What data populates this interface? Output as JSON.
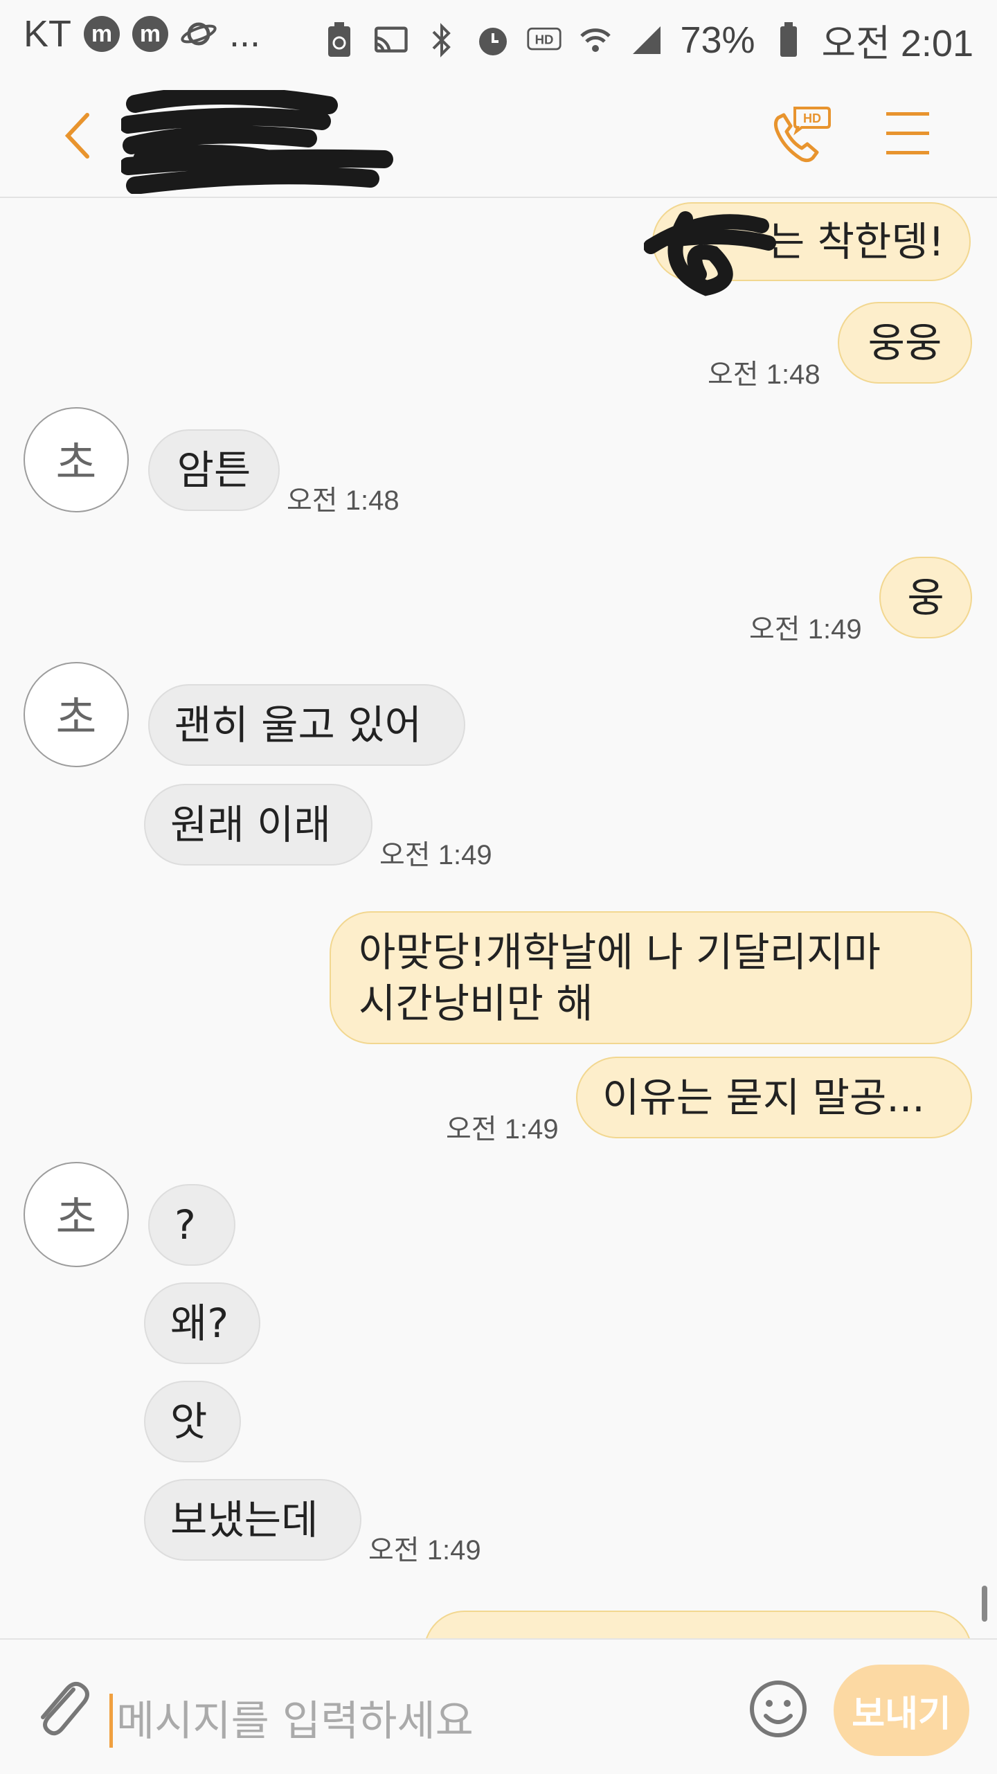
{
  "status_bar": {
    "carrier": "KT",
    "dots": "...",
    "battery_percent": "73%",
    "time": "오전 2:01",
    "icons": [
      "m-app-icon",
      "m-app-icon",
      "planet-icon",
      "battery-saver-icon",
      "cast-icon",
      "bluetooth-icon",
      "alarm-icon",
      "hd-icon",
      "wifi-icon",
      "signal-icon",
      "battery-icon"
    ]
  },
  "header": {
    "contact_name": "",
    "contact_number": "",
    "call_badge": "HD",
    "accent": "#e8942e"
  },
  "messages": {
    "m1": {
      "text": "는 착한뎅!",
      "direction": "out"
    },
    "m2": {
      "text": "웅웅",
      "direction": "out",
      "time": "오전 1:48"
    },
    "m3": {
      "text": "암튼",
      "direction": "in",
      "time": "오전 1:48"
    },
    "m4": {
      "text": "웅",
      "direction": "out",
      "time": "오전 1:49"
    },
    "m5": {
      "text": "괜히 울고 있어",
      "direction": "in"
    },
    "m6": {
      "text": "원래 이래",
      "direction": "in",
      "time": "오전 1:49"
    },
    "m7": {
      "text": "아맞당!개학날에 나 기달리지마\n시간낭비만 해",
      "direction": "out"
    },
    "m8": {
      "text": "이유는 묻지 말공...",
      "direction": "out",
      "time": "오전 1:49"
    },
    "m9": {
      "text": "?",
      "direction": "in"
    },
    "m10": {
      "text": "왜?",
      "direction": "in"
    },
    "m11": {
      "text": "앗",
      "direction": "in"
    },
    "m12": {
      "text": "보냈는데",
      "direction": "in",
      "time": "오전 1:49"
    }
  },
  "avatar_initial": "초",
  "input": {
    "placeholder": "메시지를 입력하세요",
    "value": "",
    "send_label": "보내기"
  },
  "colors": {
    "accent": "#e8942e",
    "outgoing_bubble": "#fdeecb",
    "incoming_bubble": "#ececec",
    "send_button": "#fcd9a3"
  }
}
